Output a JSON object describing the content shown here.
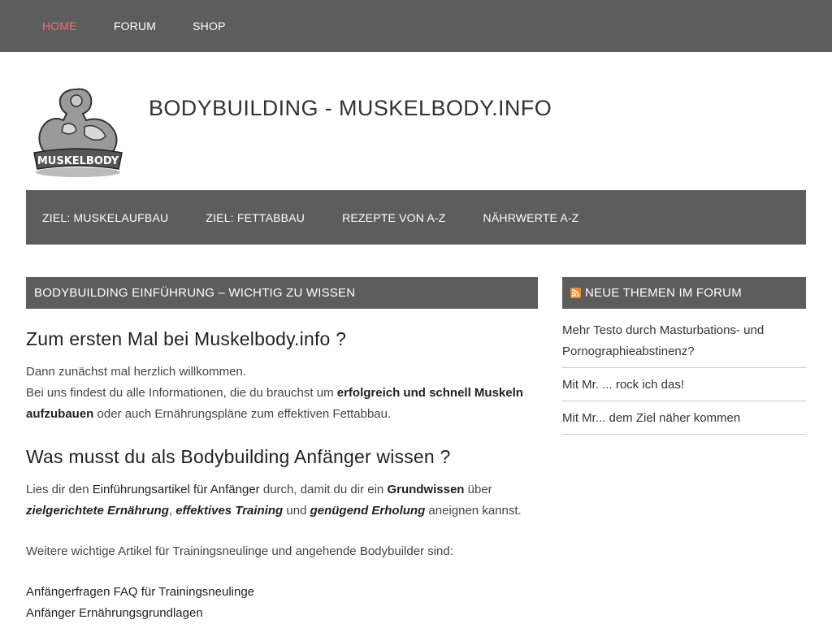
{
  "topnav": [
    {
      "label": "HOME",
      "active": true
    },
    {
      "label": "FORUM",
      "active": false
    },
    {
      "label": "SHOP",
      "active": false
    }
  ],
  "header": {
    "logo_text": "MUSKELBODY",
    "site_title": "BODYBUILDING - MUSKELBODY.INFO"
  },
  "mainnav": [
    {
      "label": "ZIEL: MUSKELAUFBAU"
    },
    {
      "label": "ZIEL: FETTABBAU"
    },
    {
      "label": "REZEPTE VON A-Z"
    },
    {
      "label": "NÄHRWERTE A-Z"
    }
  ],
  "main": {
    "section_title": "BODYBUILDING EINFÜHRUNG – WICHTIG ZU WISSEN",
    "heading1": "Zum ersten Mal bei Muskelbody.info ?",
    "p1_line1": "Dann zunächst mal herzlich willkommen.",
    "p1_a": "Bei uns findest du alle Informationen, die du brauchst um ",
    "p1_bold": "erfolgreich und schnell Muskeln aufzubauen",
    "p1_b": " oder auch Ernährungspläne zum effektiven Fettabbau.",
    "heading2": "Was musst du als Bodybuilding Anfänger wissen ?",
    "p2_a": "Lies dir den ",
    "p2_link": "Einführungsartikel für Anfänger",
    "p2_b": " durch, damit du dir ein ",
    "p2_bold": "Grundwissen",
    "p2_c": " über",
    "p2_i1": "zielgerichtete Ernährung",
    "p2_sep1": ", ",
    "p2_i2": "effektives Training",
    "p2_and": " und ",
    "p2_i3": "genügend Erholung",
    "p2_end": " aneignen kannst.",
    "p3": "Weitere wichtige Artikel für Trainingsneulinge und angehende Bodybuilder sind:",
    "links": [
      "Anfängerfragen FAQ für Trainingsneulinge",
      "Anfänger Ernährungsgrundlagen"
    ]
  },
  "sidebar": {
    "title": "NEUE THEMEN IM FORUM",
    "rss_icon": "rss-icon",
    "items": [
      "Mehr Testo durch Masturbations- und Pornographieabstinenz?",
      "Mit Mr. ... rock ich das!",
      "Mit Mr... dem Ziel näher kommen"
    ]
  },
  "colors": {
    "bar_bg": "#5d5d5d",
    "active_nav": "#f26f6f"
  }
}
